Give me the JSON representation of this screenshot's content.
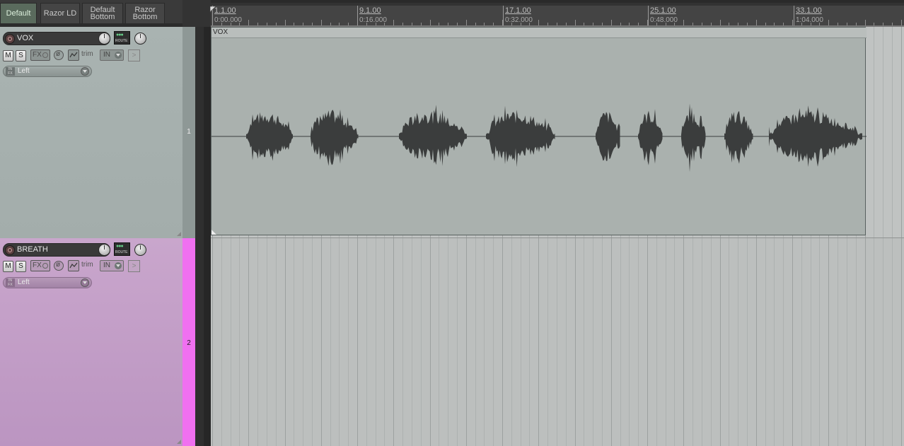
{
  "screensets": [
    {
      "label": "Default",
      "active": true
    },
    {
      "label": "Razor LD",
      "active": false
    },
    {
      "label": "Default\nBottom",
      "active": false
    },
    {
      "label": "Razor\nBottom",
      "active": false
    }
  ],
  "ruler": {
    "markers": [
      {
        "measure": "1.1.00",
        "time": "0:00.000"
      },
      {
        "measure": "9.1.00",
        "time": "0:16.000"
      },
      {
        "measure": "17.1.00",
        "time": "0:32.000"
      },
      {
        "measure": "25.1.00",
        "time": "0:48.000"
      },
      {
        "measure": "33.1.00",
        "time": "1:04.000"
      }
    ]
  },
  "tracks": [
    {
      "number": "1",
      "name": "VOX",
      "mute_label": "M",
      "solo_label": "S",
      "fx_label": "FX",
      "route_label": "ROUTE",
      "env_label": "trim",
      "input_label": "IN",
      "channel_label": "Left",
      "color": "#a9b3b1",
      "items": [
        {
          "name": "VOX",
          "color": "#aab1ae",
          "waveform_color": "#3b3d3d"
        }
      ]
    },
    {
      "number": "2",
      "name": "BREATH",
      "mute_label": "M",
      "solo_label": "S",
      "fx_label": "FX",
      "route_label": "ROUTE",
      "env_label": "trim",
      "input_label": "IN",
      "channel_label": "Left",
      "color": "#c9a6cc",
      "number_strip_color": "#f070f0",
      "items": []
    }
  ],
  "icons": {
    "record_arm": "record-arm-icon",
    "envelope": "envelope-icon",
    "phase": "phase-icon",
    "send": "send-icon",
    "input_fx": "input-fx-icon"
  }
}
